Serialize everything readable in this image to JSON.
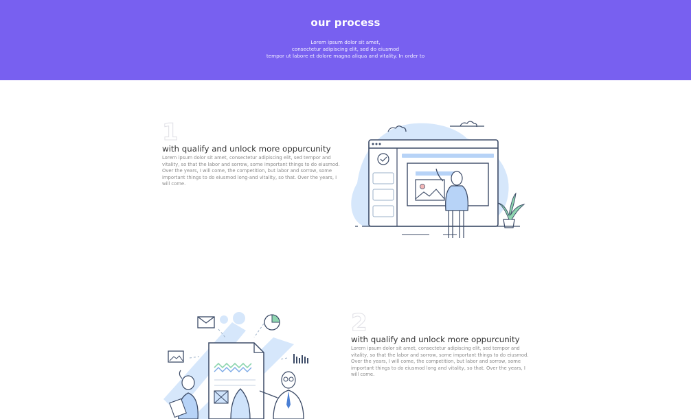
{
  "hero": {
    "title": "our process",
    "subtitle_lines": [
      "Lorem ipsum dolor sit amet,",
      "consectetur adipiscing elit, sed do eiusmod",
      "tempor ut labore et dolore magna aliqua and vitality. In order to"
    ]
  },
  "steps": [
    {
      "number": "1",
      "title": "with qualify and unlock more oppurcunity",
      "body": "Lorem ipsum dolor sit amet, consectetur adipiscing elit, sed tempor and vitality, so that the labor and sorrow, some important things to do eiusmod. Over the years, I will come, the competition, but labor and sorrow, some important things to do eiusmod long-and vitality, so that. Over the years, I will come."
    },
    {
      "number": "2",
      "title": "with qualify and unlock more oppurcunity",
      "body": "Lorem ipsum dolor sit amet, consectetur adipiscing elit, sed tempor and vitality, so that the labor and sorrow, some important things to do eiusmod. Over the years, I will come, the competition, but labor and sorrow, some important things to do eiusmod long and vitality, so that. Over the years, I will come."
    }
  ],
  "colors": {
    "hero_bg": "#7860f0",
    "illustration_blue": "#cfe3fb",
    "line": "#3b4a66",
    "plant": "#8fd6b0"
  },
  "icons": [
    "browser-window-icon",
    "presenter-person-icon",
    "plant-icon",
    "cloud-icon",
    "document-chart-icon",
    "mail-icon",
    "image-icon",
    "pie-chart-icon",
    "bar-chart-icon",
    "person-icon"
  ]
}
